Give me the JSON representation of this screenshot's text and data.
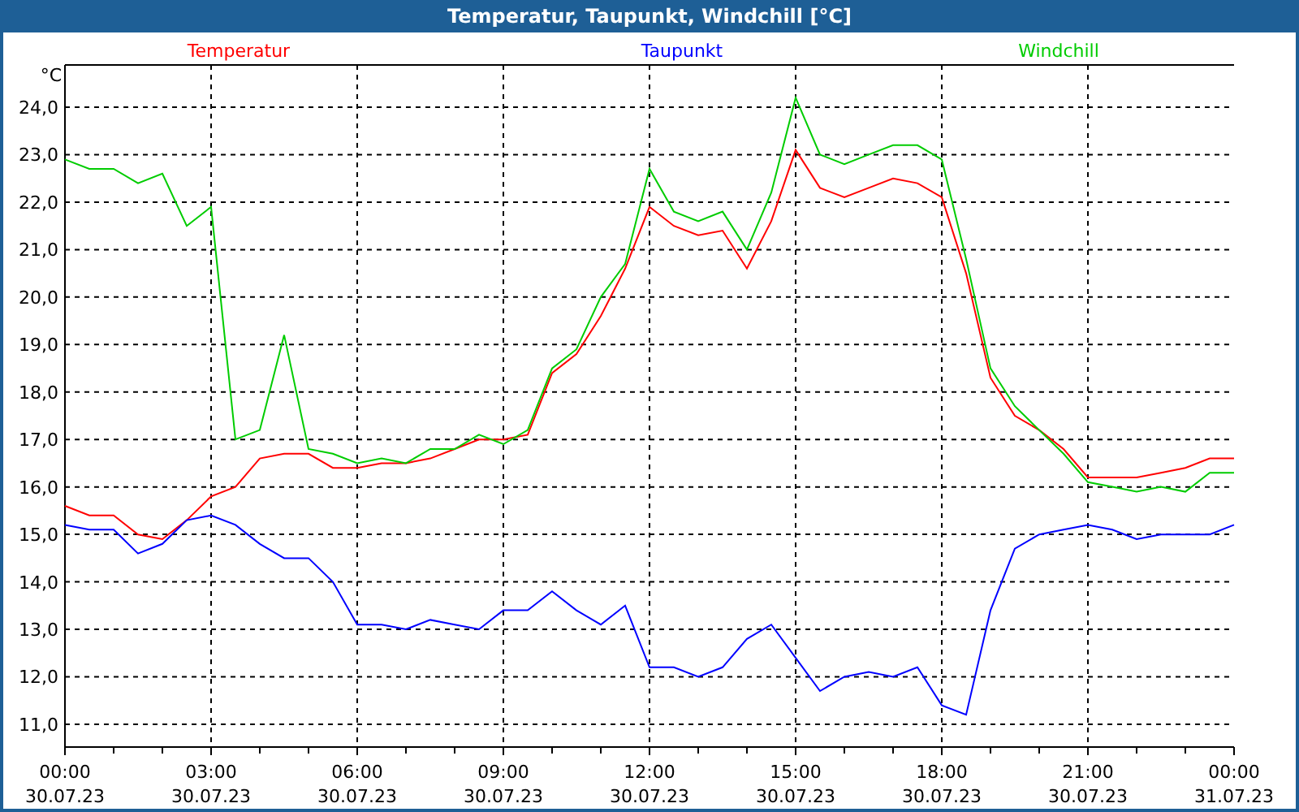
{
  "window": {
    "title": "Temperatur, Taupunkt, Windchill [°C]"
  },
  "chart": {
    "chart_data": {
      "type": "line",
      "ylabel": "°C",
      "categories": [
        "00:00 30.07.23",
        null,
        null,
        null,
        null,
        null,
        "03:00 30.07.23",
        null,
        null,
        null,
        null,
        null,
        "06:00 30.07.23",
        null,
        null,
        null,
        null,
        null,
        "09:00 30.07.23",
        null,
        null,
        null,
        null,
        null,
        "12:00 30.07.23",
        null,
        null,
        null,
        null,
        null,
        "15:00 30.07.23",
        null,
        null,
        null,
        null,
        null,
        "18:00 30.07.23",
        null,
        null,
        null,
        null,
        null,
        "21:00 30.07.23",
        null,
        null,
        null,
        null,
        null,
        "00:00 31.07.23"
      ],
      "series": [
        {
          "name": "Temperatur",
          "color": "#ff0000",
          "values": [
            15.6,
            15.4,
            15.4,
            15.0,
            14.9,
            15.3,
            15.8,
            16.0,
            16.6,
            16.7,
            16.7,
            16.4,
            16.4,
            16.5,
            16.5,
            16.6,
            16.8,
            17.0,
            17.0,
            17.1,
            18.4,
            18.8,
            19.6,
            20.6,
            21.9,
            21.5,
            21.3,
            21.4,
            20.6,
            21.6,
            23.1,
            22.3,
            22.1,
            22.3,
            22.5,
            22.4,
            22.1,
            20.5,
            18.3,
            17.5,
            17.2,
            16.8,
            16.2,
            16.2,
            16.2,
            16.3,
            16.4,
            16.6,
            16.6
          ]
        },
        {
          "name": "Taupunkt",
          "color": "#0000ff",
          "values": [
            15.2,
            15.1,
            15.1,
            14.6,
            14.8,
            15.3,
            15.4,
            15.2,
            14.8,
            14.5,
            14.5,
            14.0,
            13.1,
            13.1,
            13.0,
            13.2,
            13.1,
            13.0,
            13.4,
            13.4,
            13.8,
            13.4,
            13.1,
            13.5,
            12.2,
            12.2,
            12.0,
            12.2,
            12.8,
            13.1,
            12.4,
            11.7,
            12.0,
            12.1,
            12.0,
            12.2,
            11.4,
            11.2,
            13.4,
            14.7,
            15.0,
            15.1,
            15.2,
            15.1,
            14.9,
            15.0,
            15.0,
            15.0,
            15.2
          ]
        },
        {
          "name": "Windchill",
          "color": "#00cc00",
          "values": [
            22.9,
            22.7,
            22.7,
            22.4,
            22.6,
            21.5,
            21.9,
            17.0,
            17.2,
            19.2,
            16.8,
            16.7,
            16.5,
            16.6,
            16.5,
            16.8,
            16.8,
            17.1,
            16.9,
            17.2,
            18.5,
            18.9,
            20.0,
            20.7,
            22.7,
            21.8,
            21.6,
            21.8,
            21.0,
            22.2,
            24.2,
            23.0,
            22.8,
            23.0,
            23.2,
            23.2,
            22.9,
            20.8,
            18.5,
            17.7,
            17.2,
            16.7,
            16.1,
            16.0,
            15.9,
            16.0,
            15.9,
            16.3,
            16.3
          ]
        }
      ],
      "grid": true,
      "ylim": [
        10.52,
        24.89
      ],
      "yticks": [
        {
          "value": 11,
          "label": "11,0"
        },
        {
          "value": 12,
          "label": "12,0"
        },
        {
          "value": 13,
          "label": "13,0"
        },
        {
          "value": 14,
          "label": "14,0"
        },
        {
          "value": 15,
          "label": "15,0"
        },
        {
          "value": 16,
          "label": "16,0"
        },
        {
          "value": 17,
          "label": "17,0"
        },
        {
          "value": 18,
          "label": "18,0"
        },
        {
          "value": 19,
          "label": "19,0"
        },
        {
          "value": 20,
          "label": "20,0"
        },
        {
          "value": 21,
          "label": "21,0"
        },
        {
          "value": 22,
          "label": "22,0"
        },
        {
          "value": 23,
          "label": "23,0"
        },
        {
          "value": 24,
          "label": "24,0"
        }
      ]
    }
  }
}
